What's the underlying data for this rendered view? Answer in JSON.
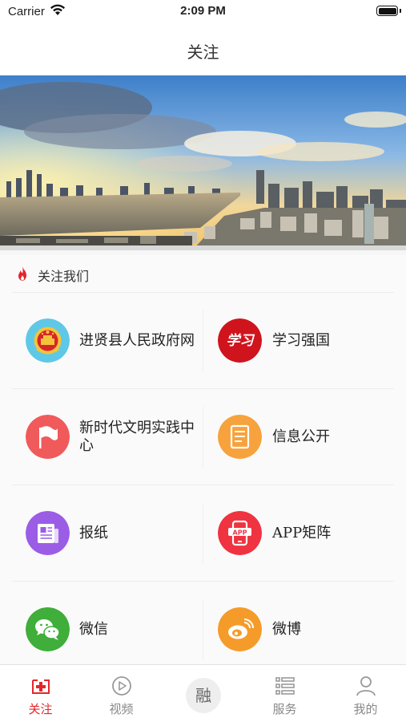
{
  "status_bar": {
    "carrier": "Carrier",
    "time": "2:09 PM"
  },
  "nav": {
    "title": "关注"
  },
  "section": {
    "title": "关注我们",
    "icon": "fire-icon"
  },
  "grid": [
    {
      "left": {
        "label": "进贤县人民政府网",
        "icon": "national-emblem-icon",
        "color": "#5fc8e6"
      },
      "right": {
        "label": "学习强国",
        "icon": "xuexi-logo-icon",
        "color": "#d0141d"
      }
    },
    {
      "left": {
        "label": "新时代文明实践中心",
        "icon": "flag-icon",
        "color": "#f05a5a"
      },
      "right": {
        "label": "信息公开",
        "icon": "document-icon",
        "color": "#f7a23c"
      }
    },
    {
      "left": {
        "label": "报纸",
        "icon": "newspaper-icon",
        "color": "#9b5de5"
      },
      "right": {
        "label": "APP矩阵",
        "icon": "app-phone-icon",
        "color": "#ef3340"
      }
    },
    {
      "left": {
        "label": "微信",
        "icon": "wechat-icon",
        "color": "#3fae3a"
      },
      "right": {
        "label": "微博",
        "icon": "weibo-icon",
        "color": "#f59b2a"
      }
    }
  ],
  "tabs": [
    {
      "label": "关注",
      "icon": "medical-cross-icon",
      "active": true
    },
    {
      "label": "视频",
      "icon": "play-icon",
      "active": false
    },
    {
      "label": "融",
      "icon": "center-rong-icon",
      "active": false
    },
    {
      "label": "服务",
      "icon": "list-icon",
      "active": false
    },
    {
      "label": "我的",
      "icon": "person-icon",
      "active": false
    }
  ],
  "colors": {
    "accent": "#e5262a",
    "inactive": "#888888"
  }
}
